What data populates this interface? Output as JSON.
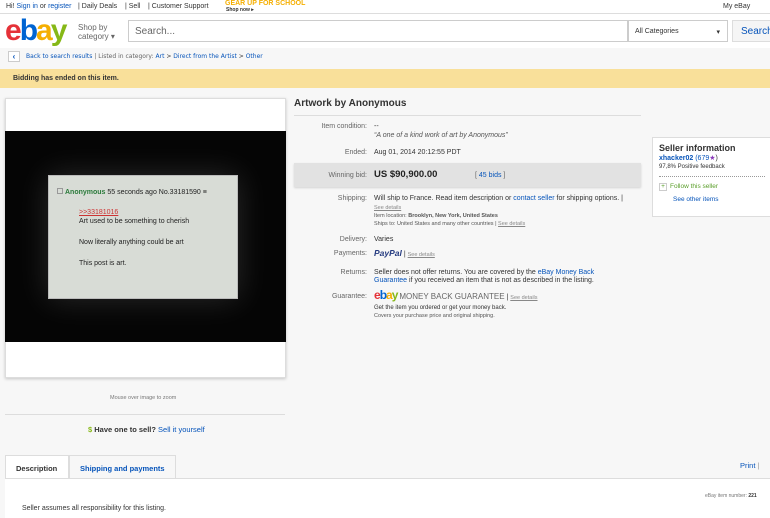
{
  "topbar": {
    "greeting": "Hi!",
    "sign_in": "Sign in",
    "or": "or",
    "register": "register",
    "daily_deals": "Daily Deals",
    "sell": "Sell",
    "customer_support": "Customer Support",
    "promo_title": "GEAR UP FOR SCHOOL",
    "promo_link": "Shop now ▸",
    "my_ebay": "My eBay"
  },
  "header": {
    "logo": [
      "e",
      "b",
      "a",
      "y"
    ],
    "shop_by": "Shop by",
    "category": "category",
    "search_placeholder": "Search...",
    "category_select": "All Categories",
    "search_button": "Search"
  },
  "breadcrumb": {
    "back": "Back to search results",
    "listed_in": "| Listed in category:",
    "items": [
      "Art",
      "Direct from the Artist",
      "Other"
    ]
  },
  "banner": "Bidding has ended on this item.",
  "photo": {
    "name": "Anonymous",
    "meta": "55 seconds ago No.33181590 ≡",
    "quote": ">>33181016",
    "line1": "Art used to be something to cherish",
    "line2": "Now literally anything could be art",
    "line3": "This post is art."
  },
  "image_hint": "Mouse over image to zoom",
  "sell": {
    "question": "Have one to sell?",
    "link": "Sell it yourself"
  },
  "item": {
    "title": "Artwork by Anonymous",
    "condition_label": "Item condition:",
    "condition": "--",
    "subtitle": "A one of a kind work of art by Anonymous",
    "ended_label": "Ended:",
    "ended": "Aug 01, 2014  20:12:55 PDT",
    "bid_label": "Winning bid:",
    "bid": "US $90,900.00",
    "bids": "45 bids",
    "shipping_label": "Shipping:",
    "shipping_a": "Will ship to France. Read item description or",
    "contact": "contact seller",
    "shipping_b": "for shipping options. |",
    "see_details": "See details",
    "location_label": "Item location:",
    "location": "Brooklyn, New York, United States",
    "ships_to_label": "Ships to:",
    "ships_to": "United States and many other countries |",
    "delivery_label": "Delivery:",
    "delivery": "Varies",
    "payments_label": "Payments:",
    "paypal": "PayPal",
    "returns_label": "Returns:",
    "returns_a": "Seller does not offer returns. You are covered by the",
    "mbg_link": "eBay Money Back Guarantee",
    "returns_b": "if you received an item that is not as described in the listing.",
    "guarantee_label": "Guarantee:",
    "mbg": "MONEY BACK GUARANTEE",
    "guarantee_1": "Get the item you ordered or get your money back.",
    "guarantee_2": "Covers your purchase price and original shipping."
  },
  "seller": {
    "title": "Seller information",
    "name": "xhacker02",
    "score": "(679",
    "feedback": "97,8% Positive feedback",
    "follow": "Follow this seller",
    "other": "See other items"
  },
  "tabs": {
    "description": "Description",
    "shipping": "Shipping and payments",
    "print": "Print",
    "item_number_label": "eBay item number:",
    "item_number": "221"
  },
  "description": "Seller assumes all responsibility for this listing.",
  "colors": {
    "accent": "#0654ba",
    "banner": "#f9e09a",
    "e": "#e53238",
    "b": "#0064d2",
    "a": "#f5af02",
    "y": "#86b817"
  }
}
